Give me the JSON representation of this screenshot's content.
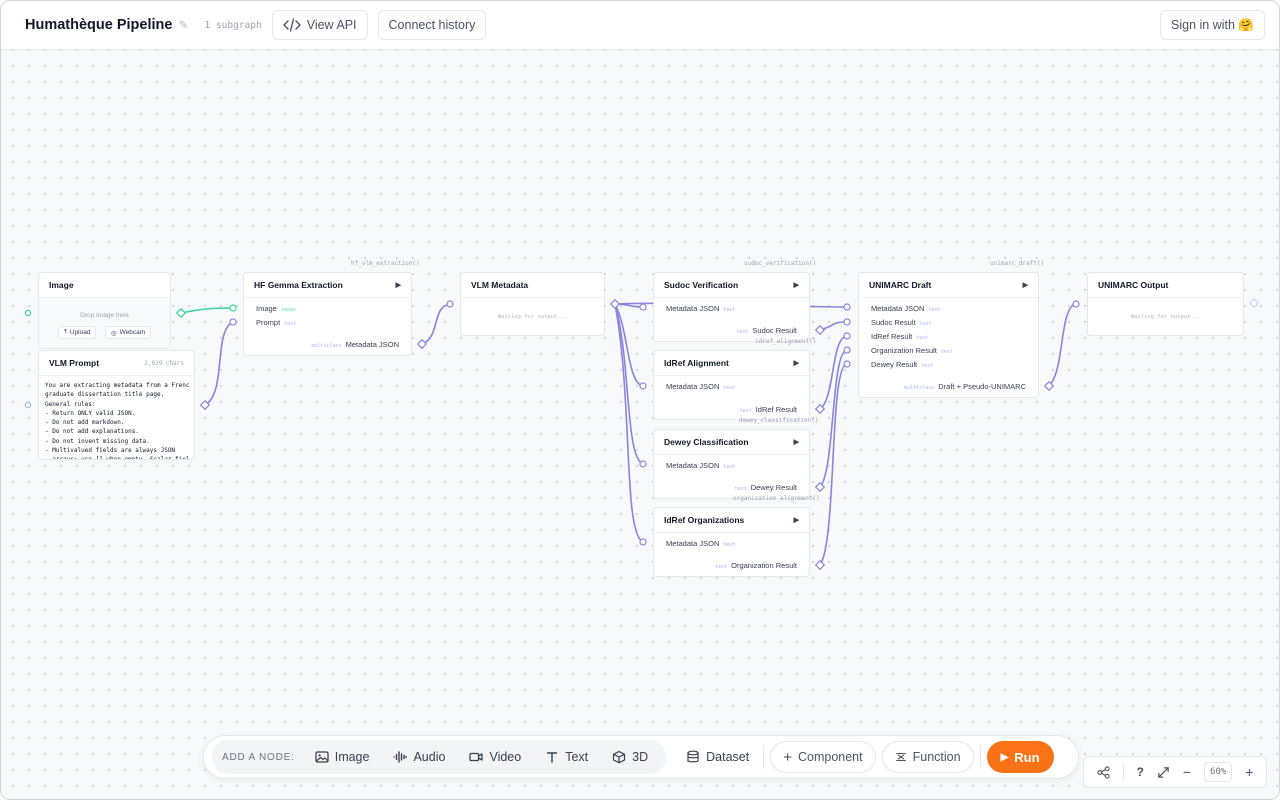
{
  "header": {
    "title": "Humathèque Pipeline",
    "subgraph": "1 subgraph",
    "view_api": "View API",
    "connect_history": "Connect history",
    "sign_in": "Sign in with 🤗"
  },
  "nodes": {
    "image": {
      "title": "Image",
      "drop": "Drop Image here",
      "upload": "Upload",
      "webcam": "Webcam"
    },
    "vlm_prompt": {
      "title": "VLM Prompt",
      "chars": "2,029 chars",
      "text": "You are extracting metadata from a French\ngraduate dissertation title page.\nGeneral rules:\n- Return ONLY valid JSON.\n- Do not add markdown.\n- Do not add explanations.\n- Do not invent missing data.\n- Multivalued fields are always JSON\n  arrays; use [] when empty. Scalar fields"
    },
    "hf_gemma": {
      "title": "HF Gemma Extraction",
      "fn": "hf_vlm_extraction()",
      "in_image": "Image",
      "in_image_type": "image",
      "in_prompt": "Prompt",
      "in_prompt_type": "text",
      "out_type": "multiclass",
      "out": "Metadata JSON"
    },
    "vlm_metadata": {
      "title": "VLM Metadata",
      "waiting": "Waiting for output..."
    },
    "sudoc": {
      "title": "Sudoc Verification",
      "fn": "sudoc_verification()",
      "in": "Metadata JSON",
      "in_type": "text",
      "out_type": "text",
      "out": "Sudoc Result"
    },
    "idref_align": {
      "title": "IdRef Alignment",
      "fn": "idref_alignment()",
      "in": "Metadata JSON",
      "in_type": "text",
      "out_type": "text",
      "out": "IdRef Result"
    },
    "dewey": {
      "title": "Dewey Classification",
      "fn": "dewey_classification()",
      "in": "Metadata JSON",
      "in_type": "text",
      "out_type": "text",
      "out": "Dewey Result"
    },
    "idref_org": {
      "title": "IdRef Organizations",
      "fn": "organization_alignment()",
      "in": "Metadata JSON",
      "in_type": "text",
      "out_type": "text",
      "out": "Organization Result"
    },
    "unimarc_draft": {
      "title": "UNIMARC Draft",
      "fn": "unimarc_draft()",
      "inputs": [
        {
          "label": "Metadata JSON",
          "type": "text"
        },
        {
          "label": "Sudoc Result",
          "type": "text"
        },
        {
          "label": "IdRef Result",
          "type": "text"
        },
        {
          "label": "Organization Result",
          "type": "text"
        },
        {
          "label": "Dewey Result",
          "type": "text"
        }
      ],
      "out_type": "multiclass",
      "out": "Draft + Pseudo-UNIMARC"
    },
    "unimarc_output": {
      "title": "UNIMARC Output",
      "waiting": "Waiting for output..."
    }
  },
  "toolbar": {
    "add_label": "ADD A NODE:",
    "image": "Image",
    "audio": "Audio",
    "video": "Video",
    "text": "Text",
    "three_d": "3D",
    "dataset": "Dataset",
    "component": "Component",
    "function": "Function",
    "run": "Run"
  },
  "controls": {
    "help": "?",
    "zoom": "60%"
  },
  "colors": {
    "accent": "#f97316",
    "wire": "#8b83dc",
    "wire_image": "#34d399"
  }
}
